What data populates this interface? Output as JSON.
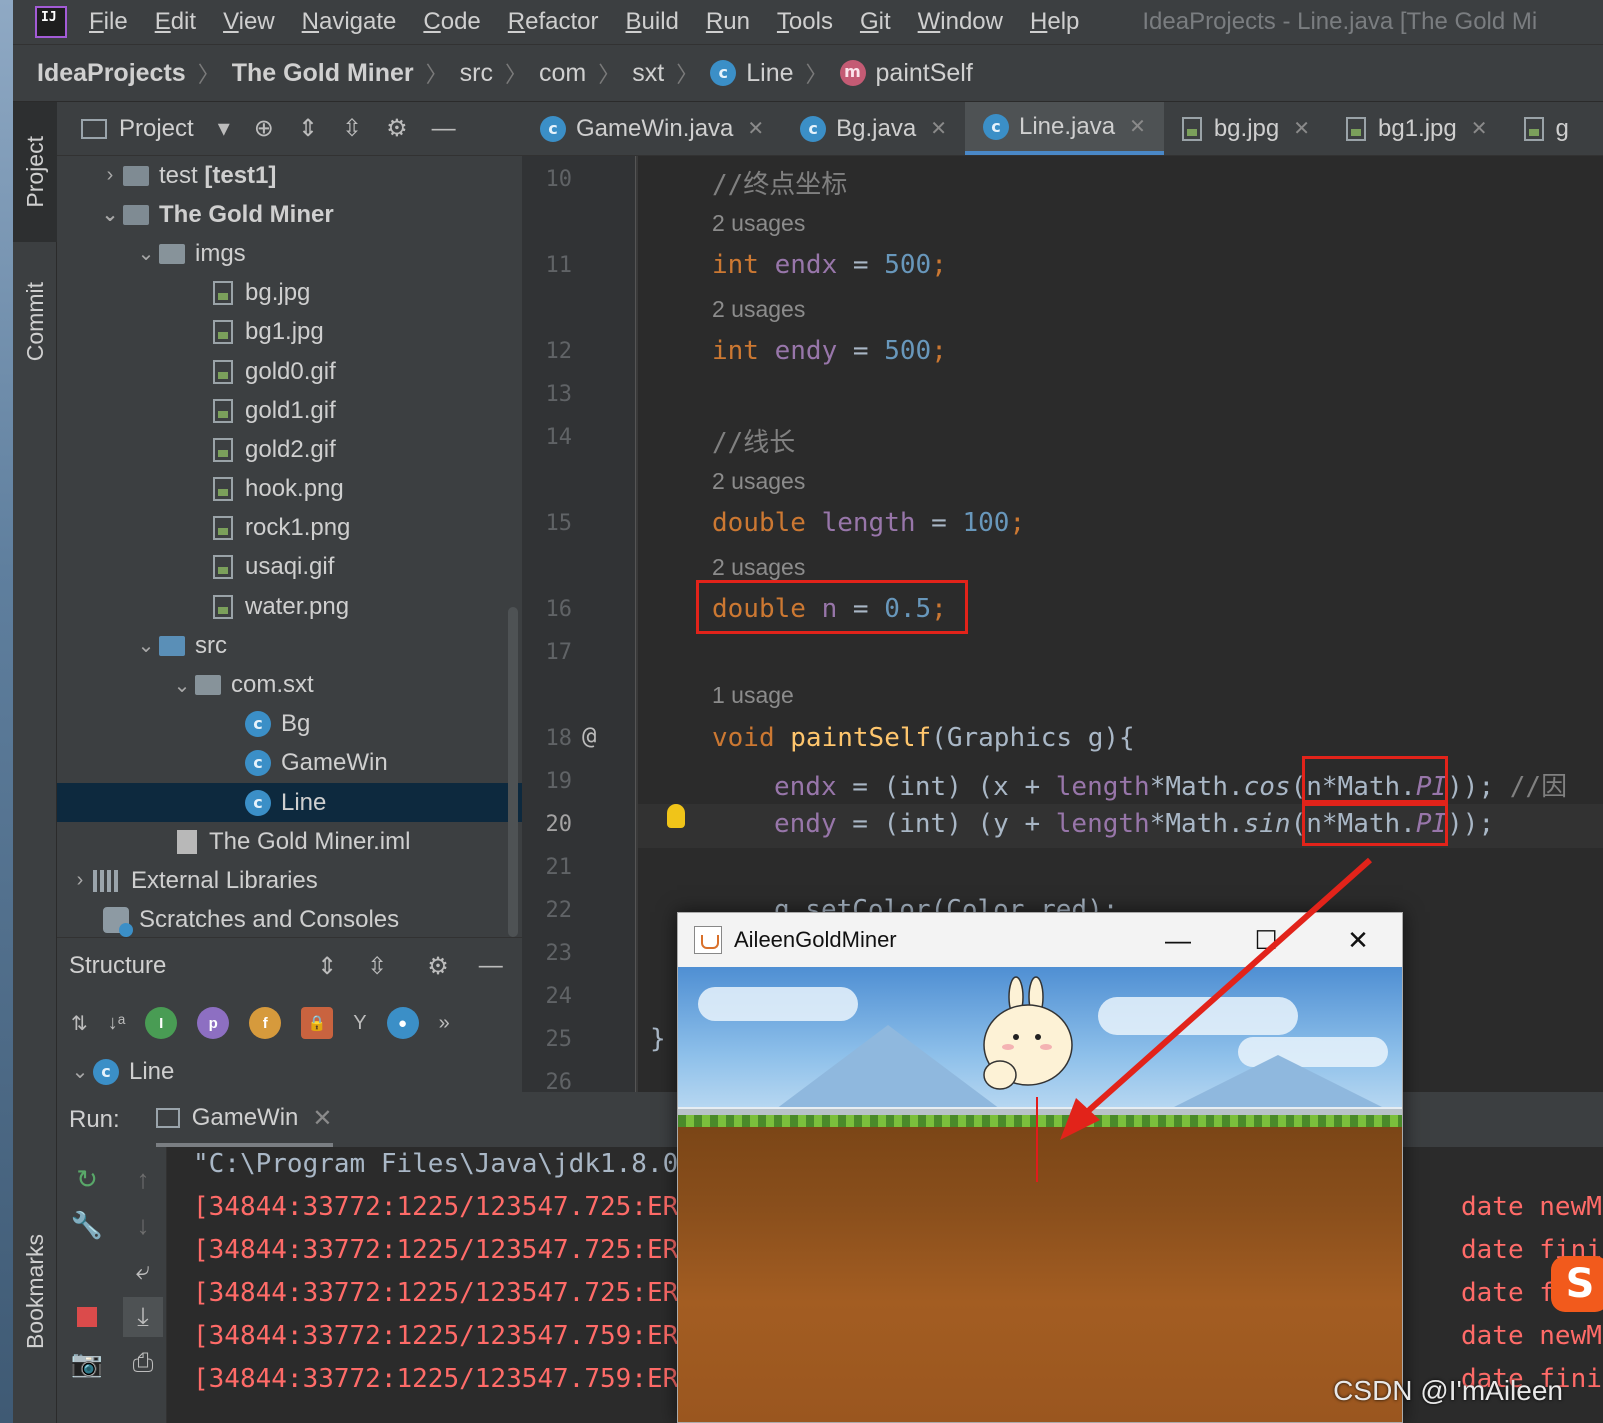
{
  "menubar": {
    "logo": "IJ",
    "items": [
      "File",
      "Edit",
      "View",
      "Navigate",
      "Code",
      "Refactor",
      "Build",
      "Run",
      "Tools",
      "Git",
      "Window",
      "Help"
    ],
    "window_title": "IdeaProjects - Line.java [The Gold Mi"
  },
  "breadcrumb": [
    "IdeaProjects",
    "The Gold Miner",
    "src",
    "com",
    "sxt",
    "Line",
    "paintSelf"
  ],
  "toolstrip": {
    "project": "Project",
    "commit": "Commit",
    "bookmarks": "Bookmarks"
  },
  "project_panel": {
    "title": "Project",
    "tree": [
      {
        "label": "test",
        "suffix": "[test1]"
      },
      {
        "label": "The Gold Miner"
      },
      {
        "label": "imgs"
      },
      {
        "label": "bg.jpg"
      },
      {
        "label": "bg1.jpg"
      },
      {
        "label": "gold0.gif"
      },
      {
        "label": "gold1.gif"
      },
      {
        "label": "gold2.gif"
      },
      {
        "label": "hook.png"
      },
      {
        "label": "rock1.png"
      },
      {
        "label": "usaqi.gif"
      },
      {
        "label": "water.png"
      },
      {
        "label": "src"
      },
      {
        "label": "com.sxt"
      },
      {
        "label": "Bg"
      },
      {
        "label": "GameWin"
      },
      {
        "label": "Line"
      },
      {
        "label": "The Gold Miner.iml"
      },
      {
        "label": "External Libraries"
      },
      {
        "label": "Scratches and Consoles"
      }
    ]
  },
  "structure_panel": {
    "title": "Structure",
    "root": "Line"
  },
  "editor_tabs": [
    {
      "label": "GameWin.java",
      "active": false
    },
    {
      "label": "Bg.java",
      "active": false
    },
    {
      "label": "Line.java",
      "active": true
    },
    {
      "label": "bg.jpg",
      "active": false
    },
    {
      "label": "bg1.jpg",
      "active": false
    },
    {
      "label": "g",
      "active": false
    }
  ],
  "editor": {
    "line_numbers": [
      "10",
      "11",
      "12",
      "13",
      "14",
      "15",
      "16",
      "17",
      "18",
      "19",
      "20",
      "21",
      "22",
      "23",
      "24",
      "25",
      "26"
    ],
    "current_line": "20",
    "usages": [
      "2 usages",
      "2 usages",
      "2 usages",
      "2 usages",
      "1 usage"
    ],
    "comment_endpoint": "//终点坐标",
    "comment_length": "//线长",
    "tokens": {
      "int": "int",
      "double": "double",
      "void": "void",
      "endx": "endx",
      "endy": "endy",
      "length": "length",
      "n": "n",
      "eq": " = ",
      "v500": "500",
      "v100": "100",
      "v05": "0.5",
      "semi": ";",
      "paintSelf": "paintSelf",
      "paintSig": "(Graphics g){",
      "line19_a": " = (int) (x + ",
      "line19_b": "*Math.",
      "cos": "cos",
      "line19_c": "(n*Math.",
      "PI": "PI",
      "line19_d": ")); ",
      "line19_cmt": "//因",
      "line20_a": " = (int) (y + ",
      "sin": "sin",
      "line20_d": "));",
      "line22": "g.setColor(Color.red);",
      "brace": "}",
      "at": "@"
    }
  },
  "run_panel": {
    "label": "Run:",
    "tab": "GameWin",
    "console": [
      "\"C:\\Program Files\\Java\\jdk1.8.0",
      "[34844:33772:1225/123547.725:ER",
      "[34844:33772:1225/123547.725:ER",
      "[34844:33772:1225/123547.725:ER",
      "[34844:33772:1225/123547.759:ER",
      "[34844:33772:1225/123547.759:ER"
    ],
    "console_tails": [
      "date newMem",
      "date finis",
      "date fini",
      "date newMem",
      "date finish"
    ]
  },
  "game_window": {
    "title": "AileenGoldMiner",
    "minimize": "—",
    "maximize": "☐",
    "close": "✕"
  },
  "watermark": "CSDN @I'mAileen",
  "sogou_icon": "S",
  "colors": {
    "keyword": "#cc7832",
    "field": "#9876aa",
    "number": "#6897bb",
    "comment": "#808080",
    "method": "#ffc66d",
    "highlight_box": "#e2231a",
    "error_text": "#ff6b68"
  }
}
